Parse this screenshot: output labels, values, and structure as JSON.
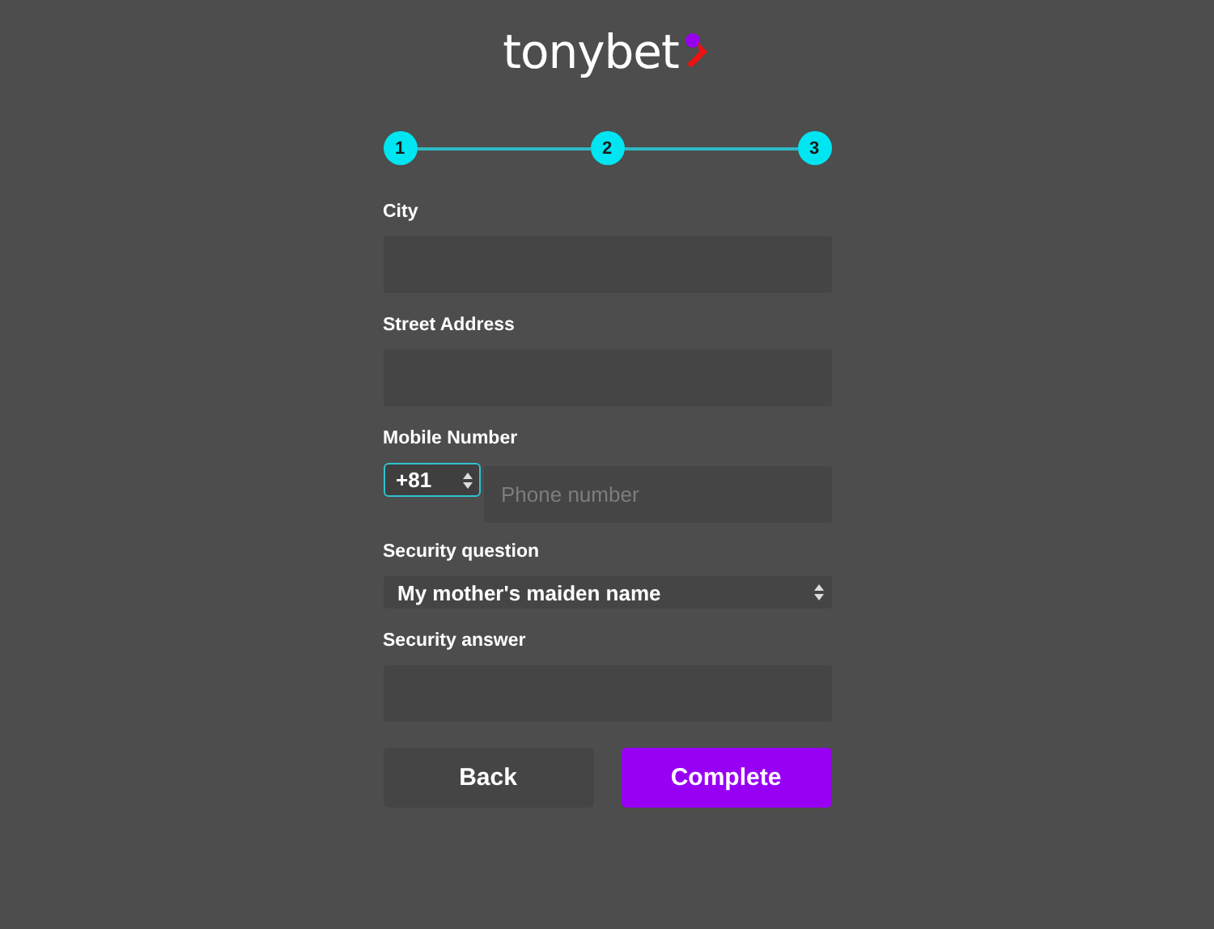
{
  "logo": {
    "text": "tonybet"
  },
  "steps": [
    {
      "label": "1",
      "done": true
    },
    {
      "label": "2",
      "done": true
    },
    {
      "label": "3",
      "done": true
    }
  ],
  "fields": [
    {
      "kind": "text",
      "label": "City"
    },
    {
      "kind": "text",
      "label": "Street Address"
    },
    {
      "kind": "phone",
      "label": "Mobile Number",
      "code": "+81",
      "placeholder": "Phone number"
    },
    {
      "kind": "select",
      "label": "Security question",
      "value": "My mother's maiden name"
    },
    {
      "kind": "text",
      "label": "Security answer"
    }
  ],
  "buttons": [
    {
      "label": "Back",
      "kind": "secondary"
    },
    {
      "label": "Complete",
      "kind": "primary"
    }
  ]
}
